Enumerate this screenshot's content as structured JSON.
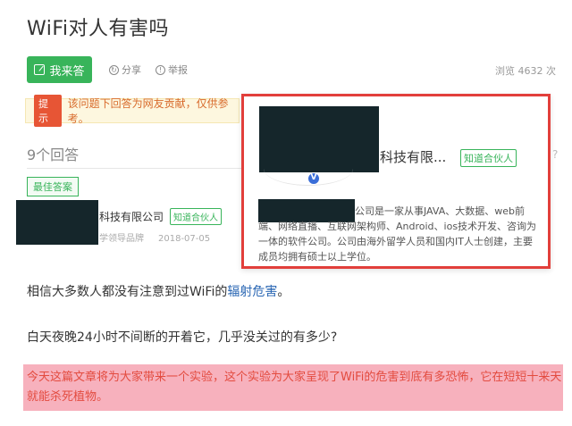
{
  "page": {
    "title": "WiFi对人有害吗"
  },
  "toolbar": {
    "answer_label": "我来答",
    "share_label": "分享",
    "report_label": "举报",
    "views_label": "浏览 4632 次"
  },
  "notice": {
    "tag": "提示",
    "text": "该问题下回答为网友贡献，仅供参考。"
  },
  "answers": {
    "count_label": "9个回答",
    "best_label": "最佳答案",
    "company_name": "科技有限公司",
    "partner_badge": "知道合伙人",
    "meta_brand": "学领导品牌",
    "date": "2018-07-05"
  },
  "popup": {
    "name": "科技有限...",
    "partner_badge": "知道合伙人",
    "verified_icon": "v-badge-icon",
    "description": "公司是一家从事JAVA、大数据、web前端、网络直播、互联网架构师、Android、ios技术开发、咨询为一体的软件公司。公司由海外留学人员和国内IT人士创建，主要成员均拥有硕士以上学位。"
  },
  "content": {
    "p1_text": "相信大多数人都没有注意到过WiFi的",
    "p1_link": "辐射危害",
    "p1_end": "。",
    "p2": "白天夜晚24小时不间断的开着它，几乎没关过的有多少?",
    "p3": "今天这篇文章将为大家带来一个实验，这个实验为大家呈现了WiFi的危害到底有多恐怖，它在短短十来天就能杀死植物。"
  },
  "colors": {
    "brand_green": "#38b45a",
    "notice_bg": "#fdf7df",
    "popup_border": "#e23f3b",
    "highlight_bg": "#f7b1bd",
    "highlight_text": "#e34b3f",
    "link": "#2966b3"
  }
}
